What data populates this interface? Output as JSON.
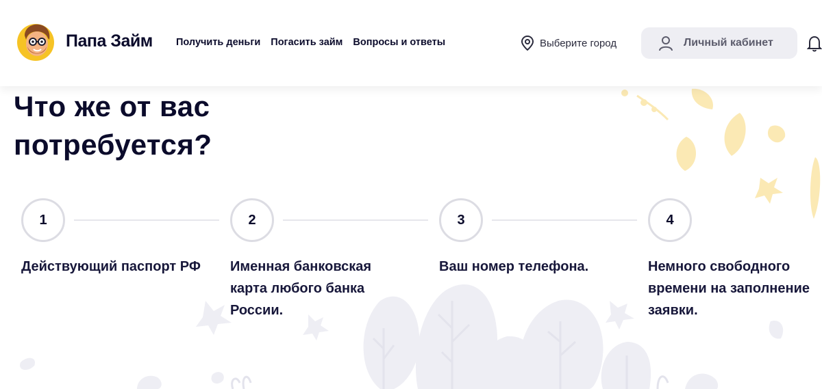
{
  "header": {
    "brand": "Папа Займ",
    "nav": [
      {
        "label": "Получить деньги"
      },
      {
        "label": "Погасить займ"
      },
      {
        "label": "Вопросы и ответы"
      }
    ],
    "city_label": "Выберите город",
    "cabinet_label": "Личный кабинет"
  },
  "main": {
    "title_line1": "Что же от вас",
    "title_line2": "потребуется?",
    "steps": [
      {
        "number": "1",
        "text": "Действующий паспорт РФ"
      },
      {
        "number": "2",
        "text": "Именная банковская карта любого банка России."
      },
      {
        "number": "3",
        "text": "Ваш номер телефона."
      },
      {
        "number": "4",
        "text": "Немного свободного времени на заполнение заявки."
      }
    ]
  },
  "colors": {
    "text": "#0b0b2b",
    "step_border": "#dcdce3",
    "cabinet_bg": "#eeeef3",
    "logo_yellow": "#f6c325",
    "leaf_yellow": "#fbe9b4",
    "tree_gray": "#eeeef4"
  },
  "icons": {
    "logo": "mascot-logo-icon",
    "city": "location-pin-icon",
    "cabinet": "user-icon",
    "bell": "bell-icon"
  }
}
